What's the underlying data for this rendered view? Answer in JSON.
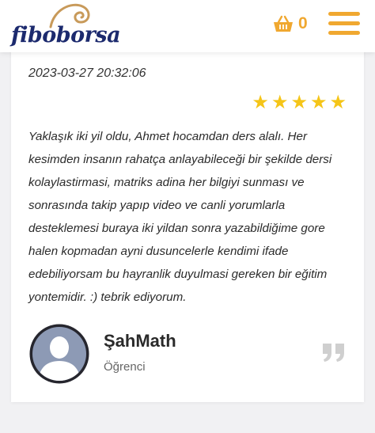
{
  "header": {
    "logo": {
      "part_a": "fibo",
      "part_b": "borsa"
    },
    "cart": {
      "icon": "basket-icon",
      "count": "0"
    },
    "menu_icon": "hamburger-menu-icon"
  },
  "review": {
    "date": "2023-03-27 20:32:06",
    "rating": 5,
    "rating_max": 5,
    "text": "Yaklaşık iki yil oldu, Ahmet hocamdan ders alalı. Her kesimden insanın rahatça anlayabileceği bir şekilde dersi kolaylastirmasi, matriks adina her bilgiyi sunması ve sonrasında takip yapıp video ve canli yorumlarla desteklemesi buraya iki yildan sonra yazabildiğime gore halen kopmadan ayni dusuncelerle kendimi ifade edebiliyorsam bu hayranlik duyulmasi gereken bir eğitim yontemidir. :) tebrik ediyorum.",
    "author": "ŞahMath",
    "role": "Öğrenci"
  },
  "colors": {
    "accent": "#f0a830",
    "brand_blue": "#1c2a6e",
    "star": "#f5c518"
  }
}
